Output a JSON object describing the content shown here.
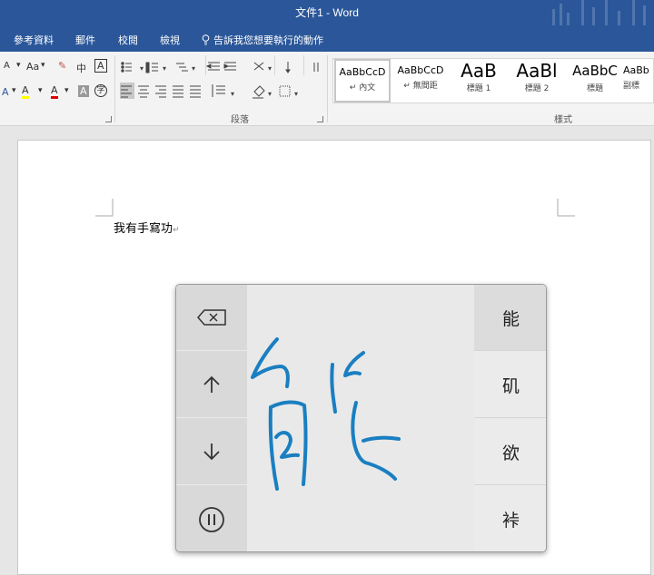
{
  "window": {
    "title": "文件1 - Word"
  },
  "menu": {
    "items": [
      "參考資料",
      "郵件",
      "校閱",
      "檢視"
    ],
    "tell_me": "告訴我您想要執行的動作"
  },
  "ribbon": {
    "font_group": {
      "size_up": "A",
      "change_case": "Aa",
      "clear_format": "中",
      "char_border": "A",
      "highlight": "A",
      "font_color": "A",
      "char_shading": "A",
      "enclose": "字"
    },
    "paragraph_label": "段落",
    "styles_label": "樣式",
    "styles": [
      {
        "preview": "AaBbCcD",
        "name": "內文",
        "selected": true
      },
      {
        "preview": "AaBbCcD",
        "name": "無間距"
      },
      {
        "preview": "AaB",
        "name": "標題 1"
      },
      {
        "preview": "AaBl",
        "name": "標題 2"
      },
      {
        "preview": "AaBbC",
        "name": "標題"
      },
      {
        "preview": "AaBb",
        "name": "副標"
      }
    ]
  },
  "document": {
    "text": "我有手寫功"
  },
  "handwriting": {
    "left_keys": [
      "backspace-icon",
      "arrow-up-icon",
      "arrow-down-icon",
      "pause-icon"
    ],
    "candidates": [
      "能",
      "矶",
      "欲",
      "裃"
    ],
    "ink_color": "#1a7fc1"
  },
  "colors": {
    "accent": "#2b579a",
    "highlight_yellow": "#ffff00",
    "font_red": "#e00000"
  }
}
